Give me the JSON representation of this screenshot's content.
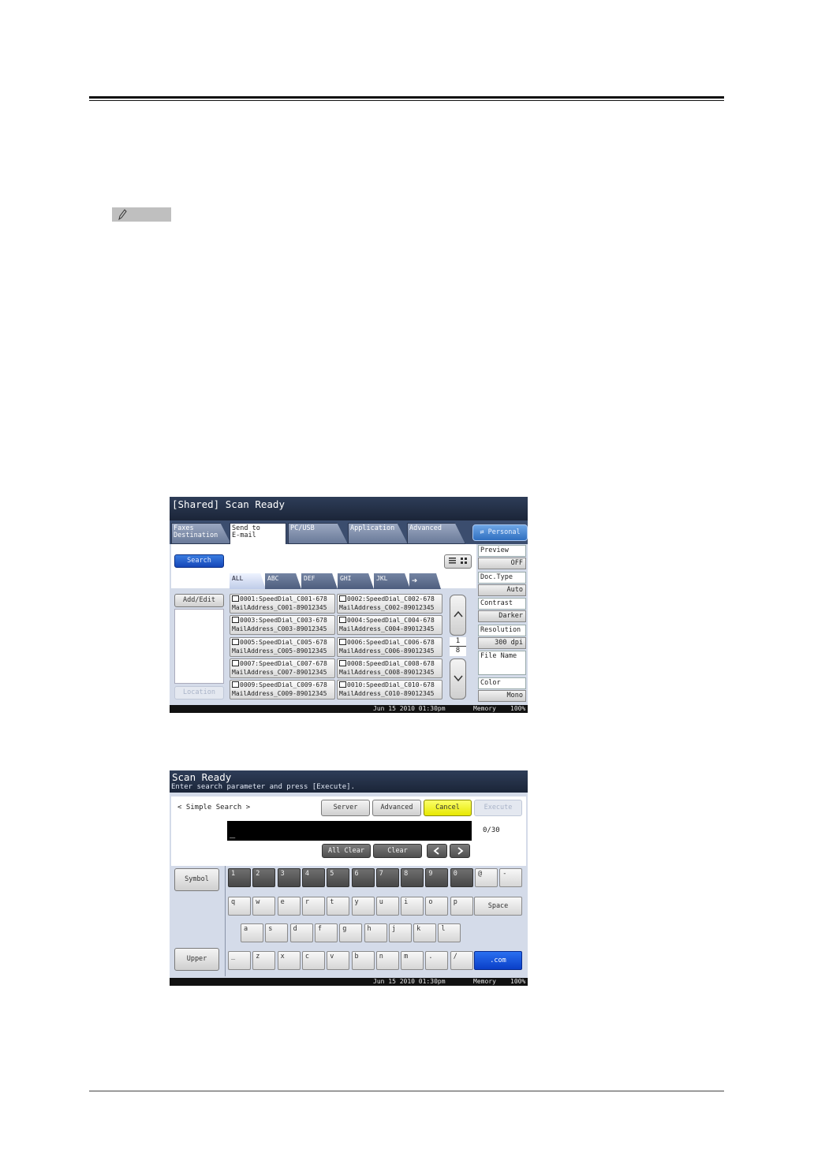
{
  "screen1": {
    "title": "[Shared] Scan Ready",
    "tabs": [
      {
        "label": "Faxes\nDestination"
      },
      {
        "label": "Send to\nE-mail"
      },
      {
        "label": "PC/USB"
      },
      {
        "label": "Application"
      },
      {
        "label": "Advanced"
      }
    ],
    "personal_label": "Personal",
    "search_label": "Search",
    "alpha_tabs": [
      "ALL",
      "ABC",
      "DEF",
      "GHI",
      "JKL"
    ],
    "add_edit_label": "Add/Edit",
    "location_label": "Location",
    "entries": [
      {
        "line1": "0001:SpeedDial_C001-678",
        "line2": "MailAddress_C001-89012345"
      },
      {
        "line1": "0002:SpeedDial_C002-678",
        "line2": "MailAddress_C002-89012345"
      },
      {
        "line1": "0003:SpeedDial_C003-678",
        "line2": "MailAddress_C003-89012345"
      },
      {
        "line1": "0004:SpeedDial_C004-678",
        "line2": "MailAddress_C004-89012345"
      },
      {
        "line1": "0005:SpeedDial_C005-678",
        "line2": "MailAddress_C005-89012345"
      },
      {
        "line1": "0006:SpeedDial_C006-678",
        "line2": "MailAddress_C006-89012345"
      },
      {
        "line1": "0007:SpeedDial_C007-678",
        "line2": "MailAddress_C007-89012345"
      },
      {
        "line1": "0008:SpeedDial_C008-678",
        "line2": "MailAddress_C008-89012345"
      },
      {
        "line1": "0009:SpeedDial_C009-678",
        "line2": "MailAddress_C009-89012345"
      },
      {
        "line1": "0010:SpeedDial_C010-678",
        "line2": "MailAddress_C010-89012345"
      }
    ],
    "page_current": "1",
    "page_total": "8",
    "settings": [
      {
        "label": "Preview",
        "value": "OFF"
      },
      {
        "label": "Doc.Type",
        "value": "Auto"
      },
      {
        "label": "Contrast",
        "value": "Darker"
      },
      {
        "label": "Resolution",
        "value": "300 dpi"
      },
      {
        "label": "File Name",
        "value": ""
      },
      {
        "label": "Color",
        "value": "Mono"
      }
    ],
    "status": {
      "datetime": "Jun 15 2010 01:30pm",
      "memory_label": "Memory",
      "memory_value": "100%"
    }
  },
  "screen2": {
    "title": "Scan Ready",
    "subtitle": "Enter search parameter and press [Execute].",
    "mode_label": "< Simple Search >",
    "buttons": {
      "server": "Server",
      "advanced": "Advanced",
      "cancel": "Cancel",
      "execute": "Execute"
    },
    "input_value": "_",
    "char_count": "0/30",
    "all_clear_label": "All Clear",
    "clear_label": "Clear",
    "symbol_label": "Symbol",
    "upper_label": "Upper",
    "space_label": "Space",
    "dotcom_label": ".com",
    "row1": [
      "1",
      "2",
      "3",
      "4",
      "5",
      "6",
      "7",
      "8",
      "9",
      "0",
      "@",
      "-"
    ],
    "row2": [
      "q",
      "w",
      "e",
      "r",
      "t",
      "y",
      "u",
      "i",
      "o",
      "p"
    ],
    "row3": [
      "a",
      "s",
      "d",
      "f",
      "g",
      "h",
      "j",
      "k",
      "l"
    ],
    "row4": [
      "_",
      "z",
      "x",
      "c",
      "v",
      "b",
      "n",
      "m",
      ".",
      "/"
    ],
    "status": {
      "datetime": "Jun 15 2010 01:30pm",
      "memory_label": "Memory",
      "memory_value": "100%"
    }
  },
  "colors": {
    "accent_blue": "#1546b8",
    "cancel_yellow": "#e8e800",
    "titlebar": "#1b2538"
  }
}
